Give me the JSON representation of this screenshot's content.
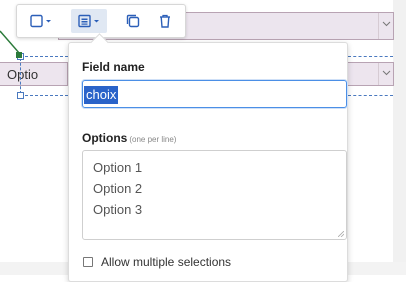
{
  "toolbar": {
    "buttons": [
      {
        "name": "field-type-dropdown",
        "icon": "square-dropdown-icon",
        "active": false
      },
      {
        "name": "field-settings-dropdown",
        "icon": "list-dropdown-icon",
        "active": true
      },
      {
        "name": "duplicate",
        "icon": "copy-icon",
        "active": false
      },
      {
        "name": "delete",
        "icon": "trash-icon",
        "active": false
      }
    ]
  },
  "canvas": {
    "left_field_text": "Optio"
  },
  "panel": {
    "field_name_label": "Field name",
    "field_name_value": "choix",
    "options_label": "Options",
    "options_hint": "(one per line)",
    "options": [
      "Option 1",
      "Option 2",
      "Option 3"
    ],
    "allow_multiple_label": "Allow multiple selections",
    "allow_multiple_checked": false
  },
  "colors": {
    "accent": "#2a63c9",
    "field_bg": "#ece5ee",
    "field_border": "#b8a3b3",
    "guide": "#4a79bf",
    "connector": "#2b7a3a"
  }
}
